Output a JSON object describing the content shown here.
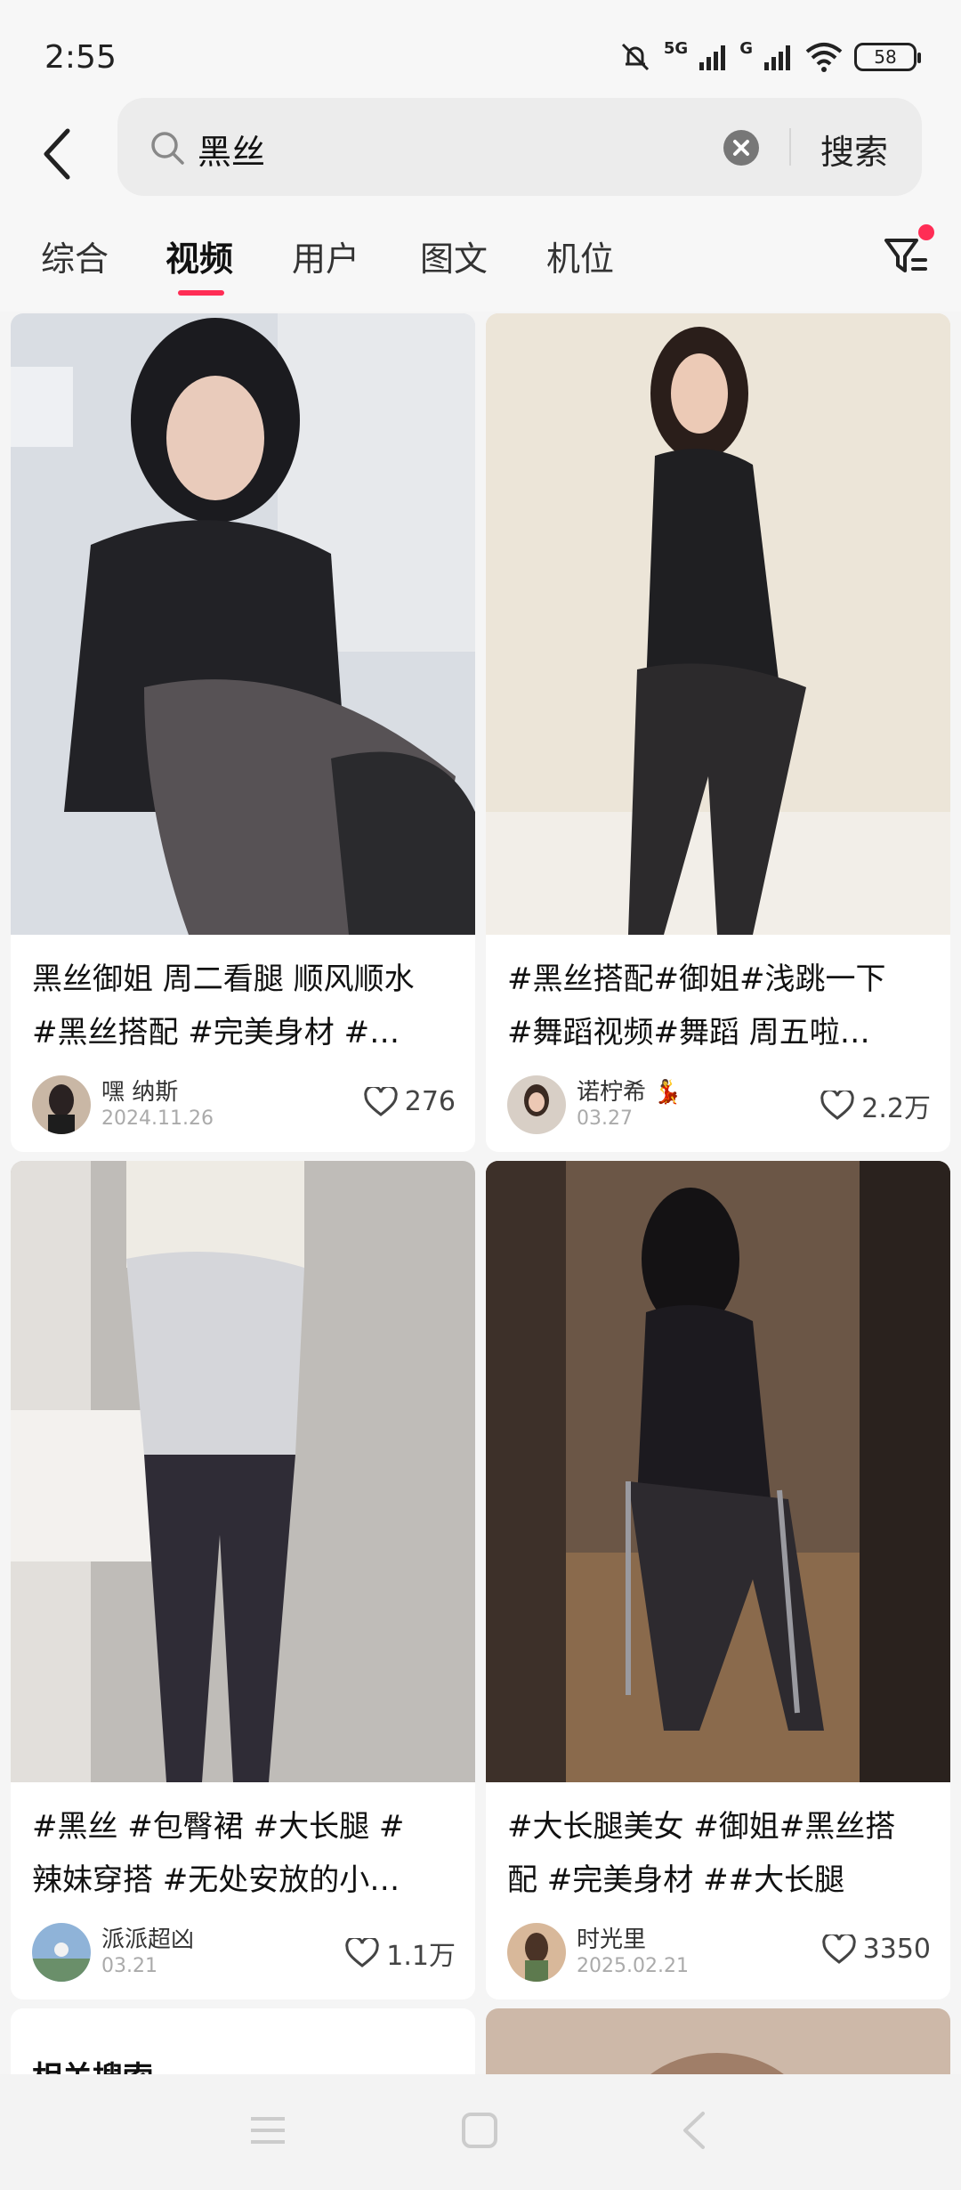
{
  "status": {
    "time": "2:55",
    "battery": "58",
    "net1": "5G",
    "net2": "G"
  },
  "search": {
    "query": "黑丝",
    "button": "搜索"
  },
  "tabs": [
    {
      "label": "综合"
    },
    {
      "label": "视频"
    },
    {
      "label": "用户"
    },
    {
      "label": "图文"
    },
    {
      "label": "机位"
    }
  ],
  "active_tab": "视频",
  "cards": [
    {
      "caption_l1": "黑丝御姐 周二看腿 顺风顺水",
      "caption_l2": "#黑丝搭配 #完美身材 #…",
      "author": "嘿 纳斯",
      "date": "2024.11.26",
      "likes": "276"
    },
    {
      "caption_l1": "#黑丝搭配#御姐#浅跳一下",
      "caption_l2": "#舞蹈视频#舞蹈 周五啦…",
      "author": "诺柠希 💃",
      "date": "03.27",
      "likes": "2.2万"
    },
    {
      "caption_l1": "#黑丝 #包臀裙 #大长腿 #",
      "caption_l2": "辣妹穿搭 #无处安放的小…",
      "author": "派派超凶",
      "date": "03.21",
      "likes": "1.1万"
    },
    {
      "caption_l1": "#大长腿美女 #御姐#黑丝搭",
      "caption_l2": "配 #完美身材 ##大长腿",
      "author": "时光里",
      "date": "2025.02.21",
      "likes": "3350"
    }
  ],
  "related": {
    "title": "相关搜索"
  },
  "colors": {
    "accent": "#ff2d55",
    "background": "#f5f5f5"
  }
}
